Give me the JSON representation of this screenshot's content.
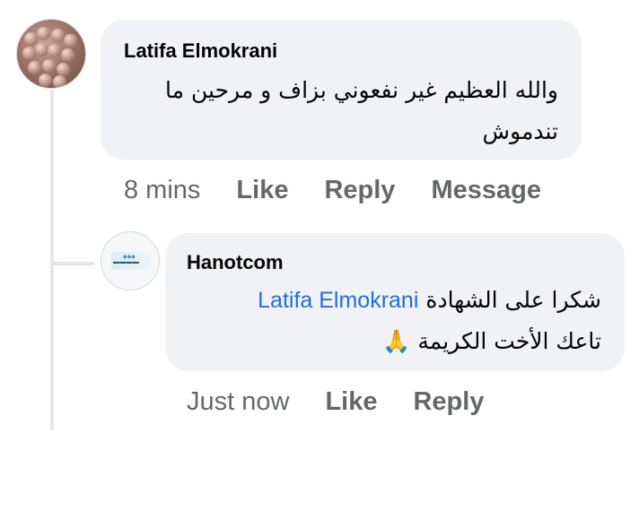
{
  "comment": {
    "author": "Latifa Elmokrani",
    "text_line1": "والله العظيم غير نفعوني بزاف و مرحين ما",
    "text_line2": "تندموش",
    "time": "8 mins",
    "actions": {
      "like": "Like",
      "reply": "Reply",
      "message": "Message"
    }
  },
  "reply": {
    "author": "Hanotcom",
    "mention": "Latifa Elmokrani",
    "text_line1": "شكرا على الشهادة",
    "text_line2": "تاعك الأخت الكريمة",
    "emoji": "🙏",
    "time": "Just now",
    "actions": {
      "like": "Like",
      "reply": "Reply"
    }
  },
  "colors": {
    "bubble": "#f0f2f5",
    "secondary_text": "#65676b",
    "mention": "#216fdb",
    "thread_line": "#e4e6eb"
  }
}
